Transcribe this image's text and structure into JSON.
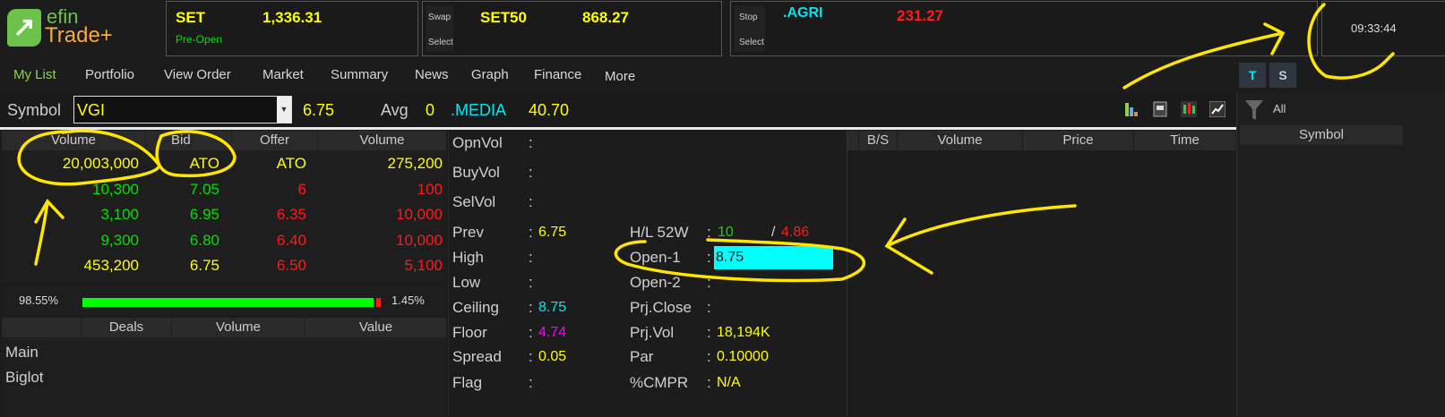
{
  "logo": {
    "line1": "efin",
    "line2": "Trade+"
  },
  "ticker1": {
    "name": "SET",
    "value": "1,336.31",
    "status": "Pre-Open"
  },
  "ticker2": {
    "btn_top": "Swap",
    "btn_bottom": "Select",
    "name": "SET50",
    "value": "868.27"
  },
  "ticker3": {
    "btn_top": "Stop",
    "btn_bottom": "Select",
    "name": ".AGRI",
    "value": "231.27"
  },
  "clock": "09:33:44",
  "menu": [
    "My List",
    "Portfolio",
    "View Order",
    "Market",
    "Summary",
    "News",
    "Graph",
    "Finance",
    "More"
  ],
  "toggles": [
    "T",
    "S"
  ],
  "symbol_bar": {
    "label": "Symbol",
    "value": "VGI",
    "last": "6.75",
    "avg_label": "Avg",
    "avg": "0",
    "sector": ".MEDIA",
    "sector_value": "40.70"
  },
  "filter": {
    "label": "All"
  },
  "right_panel": {
    "header": "Symbol"
  },
  "bidoffer": {
    "headers": [
      "Volume",
      "Bid",
      "Offer",
      "Volume"
    ],
    "rows": [
      [
        "20,003,000",
        "ATO",
        "ATO",
        "275,200"
      ],
      [
        "10,300",
        "7.05",
        "6",
        "100"
      ],
      [
        "3,100",
        "6.95",
        "6.35",
        "10,000"
      ],
      [
        "9,300",
        "6.80",
        "6.40",
        "10,000"
      ],
      [
        "453,200",
        "6.75",
        "6.50",
        "5,100"
      ]
    ]
  },
  "ratio": {
    "buy": "98.55%",
    "sell": "1.45%",
    "buy_fraction": 0.9855
  },
  "deals": {
    "headers": [
      "Deals",
      "Volume",
      "Value"
    ],
    "rows": [
      "Main",
      "Biglot"
    ]
  },
  "info_left": [
    {
      "label": "OpnVol",
      "value": ""
    },
    {
      "label": "BuyVol",
      "value": ""
    },
    {
      "label": "SelVol",
      "value": ""
    },
    {
      "label": "Prev",
      "value": "6.75"
    },
    {
      "label": "High",
      "value": ""
    },
    {
      "label": "Low",
      "value": ""
    },
    {
      "label": "Ceiling",
      "value": "8.75"
    },
    {
      "label": "Floor",
      "value": "4.74"
    },
    {
      "label": "Spread",
      "value": "0.05"
    },
    {
      "label": "Flag",
      "value": ""
    }
  ],
  "info_right": {
    "hl52w": {
      "label": "H/L 52W",
      "high": "10",
      "sep": "/",
      "low": "4.86"
    },
    "rows": [
      {
        "label": "Open-1",
        "value": "8.75"
      },
      {
        "label": "Open-2",
        "value": ""
      },
      {
        "label": "Prj.Close",
        "value": ""
      },
      {
        "label": "Prj.Vol",
        "value": "18,194K"
      },
      {
        "label": "Par",
        "value": "0.10000"
      },
      {
        "label": "%CMPR",
        "value": "N/A"
      }
    ]
  },
  "ticker_table": {
    "headers": [
      "B/S",
      "Volume",
      "Price",
      "Time"
    ]
  },
  "colors": {
    "bg": "#1c1c1c",
    "up": "#00e000",
    "down": "#ff1a1a",
    "neutral": "#ffff00",
    "ceiling": "#00e5ee",
    "floor": "#ff00ff",
    "annotation": "#ffe600"
  }
}
